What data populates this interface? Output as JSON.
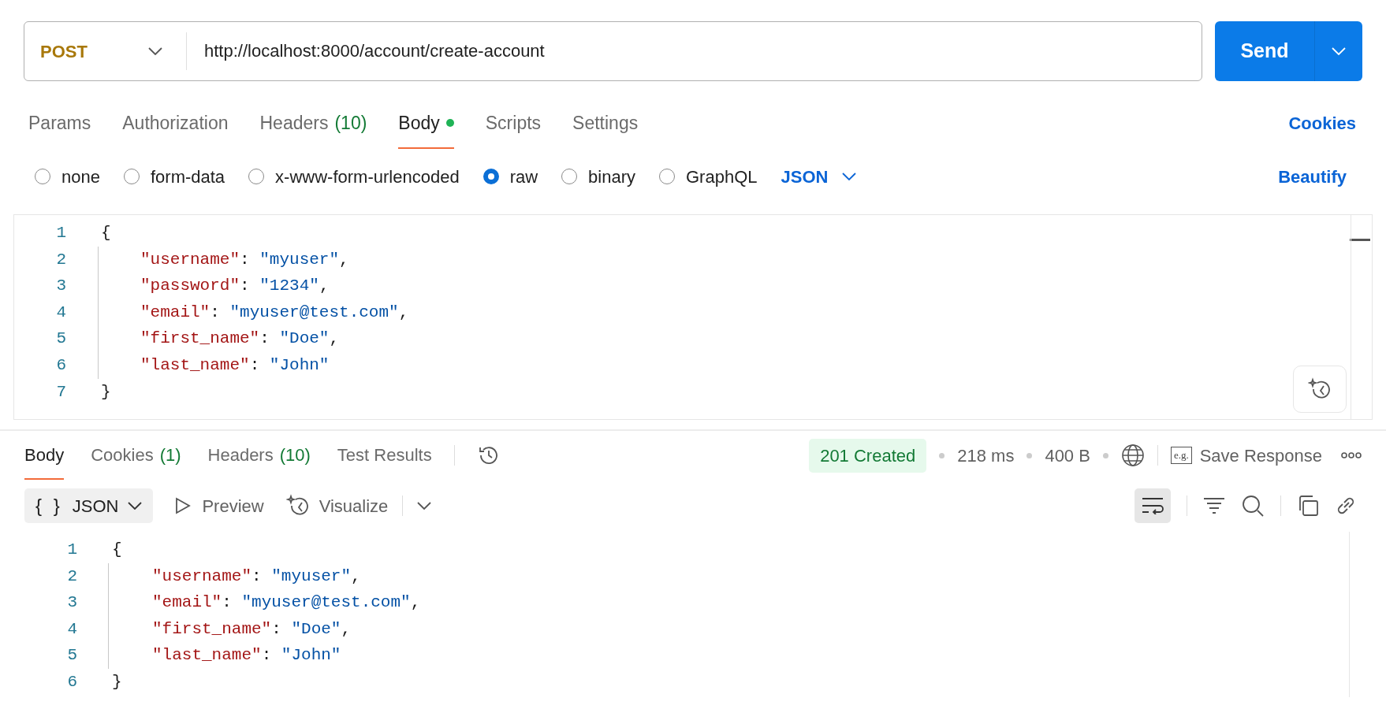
{
  "request": {
    "method": "POST",
    "url": "http://localhost:8000/account/create-account",
    "send": "Send"
  },
  "request_tabs": [
    {
      "label": "Params",
      "selected": false
    },
    {
      "label": "Authorization",
      "selected": false
    },
    {
      "label": "Headers",
      "count": "(10)",
      "selected": false
    },
    {
      "label": "Body",
      "selected": true,
      "dot": true
    },
    {
      "label": "Scripts",
      "selected": false
    },
    {
      "label": "Settings",
      "selected": false
    }
  ],
  "cookies_link": "Cookies",
  "body_types": [
    {
      "label": "none",
      "selected": false
    },
    {
      "label": "form-data",
      "selected": false
    },
    {
      "label": "x-www-form-urlencoded",
      "selected": false
    },
    {
      "label": "raw",
      "selected": true
    },
    {
      "label": "binary",
      "selected": false
    },
    {
      "label": "GraphQL",
      "selected": false
    }
  ],
  "format": "JSON",
  "beautify": "Beautify",
  "request_body": [
    {
      "number": "1",
      "tokens": [
        {
          "kind": "punct",
          "text": "{"
        }
      ],
      "children": [
        {
          "number": "2",
          "tokens": [
            {
              "kind": "key",
              "text": "\"username\""
            },
            {
              "kind": "punct",
              "text": ": "
            },
            {
              "kind": "string",
              "text": "\"myuser\""
            },
            {
              "kind": "punct",
              "text": ","
            }
          ]
        },
        {
          "number": "3",
          "tokens": [
            {
              "kind": "key",
              "text": "\"password\""
            },
            {
              "kind": "punct",
              "text": ": "
            },
            {
              "kind": "string",
              "text": "\"1234\""
            },
            {
              "kind": "punct",
              "text": ","
            }
          ]
        },
        {
          "number": "4",
          "tokens": [
            {
              "kind": "key",
              "text": "\"email\""
            },
            {
              "kind": "punct",
              "text": ": "
            },
            {
              "kind": "string",
              "text": "\"myuser@test.com\""
            },
            {
              "kind": "punct",
              "text": ","
            }
          ]
        },
        {
          "number": "5",
          "tokens": [
            {
              "kind": "key",
              "text": "\"first_name\""
            },
            {
              "kind": "punct",
              "text": ": "
            },
            {
              "kind": "string",
              "text": "\"Doe\""
            },
            {
              "kind": "punct",
              "text": ","
            }
          ]
        },
        {
          "number": "6",
          "tokens": [
            {
              "kind": "key",
              "text": "\"last_name\""
            },
            {
              "kind": "punct",
              "text": ": "
            },
            {
              "kind": "string",
              "text": "\"John\""
            }
          ]
        }
      ]
    },
    {
      "number": "7",
      "tokens": [
        {
          "kind": "punct",
          "text": "}"
        }
      ]
    }
  ],
  "response_tabs": [
    {
      "label": "Body",
      "selected": true
    },
    {
      "label": "Cookies",
      "count": "(1)",
      "selected": false
    },
    {
      "label": "Headers",
      "count": "(10)",
      "selected": false
    },
    {
      "label": "Test Results",
      "selected": false
    }
  ],
  "status": {
    "code": "201 Created",
    "time": "218 ms",
    "size": "400 B",
    "save_icon_text": "e.g.",
    "save": "Save Response"
  },
  "response_view": {
    "format": "JSON",
    "format_braces": "{ }",
    "preview": "Preview",
    "visualize": "Visualize",
    "wrap_on": true
  },
  "response_body": [
    {
      "number": "1",
      "tokens": [
        {
          "kind": "punct",
          "text": "{"
        }
      ],
      "children": [
        {
          "number": "2",
          "tokens": [
            {
              "kind": "key",
              "text": "\"username\""
            },
            {
              "kind": "punct",
              "text": ": "
            },
            {
              "kind": "string",
              "text": "\"myuser\""
            },
            {
              "kind": "punct",
              "text": ","
            }
          ]
        },
        {
          "number": "3",
          "tokens": [
            {
              "kind": "key",
              "text": "\"email\""
            },
            {
              "kind": "punct",
              "text": ": "
            },
            {
              "kind": "string",
              "text": "\"myuser@test.com\""
            },
            {
              "kind": "punct",
              "text": ","
            }
          ]
        },
        {
          "number": "4",
          "tokens": [
            {
              "kind": "key",
              "text": "\"first_name\""
            },
            {
              "kind": "punct",
              "text": ": "
            },
            {
              "kind": "string",
              "text": "\"Doe\""
            },
            {
              "kind": "punct",
              "text": ","
            }
          ]
        },
        {
          "number": "5",
          "tokens": [
            {
              "kind": "key",
              "text": "\"last_name\""
            },
            {
              "kind": "punct",
              "text": ": "
            },
            {
              "kind": "string",
              "text": "\"John\""
            }
          ]
        }
      ]
    },
    {
      "number": "6",
      "tokens": [
        {
          "kind": "punct",
          "text": "}"
        }
      ]
    }
  ]
}
